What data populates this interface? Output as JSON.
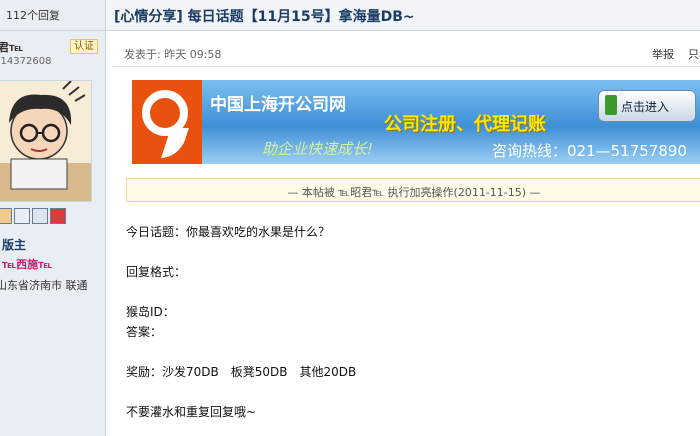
{
  "left": {
    "replies": "112个回复",
    "username": "君℡",
    "verify_badge": "认证",
    "uid": ": 14372608",
    "role": "版主",
    "nickname": "℡西施℡",
    "location": "山东省济南市 联通"
  },
  "thread": {
    "title": "[心情分享] 每日话题【11月15号】拿海量DB~",
    "posted": "发表于: 昨天 09:58",
    "report": "举报",
    "reply_link": "只看"
  },
  "banner": {
    "company": "中国上海开公司网",
    "service": "公司注册、代理记账",
    "slogan": "助企业快速成长!",
    "hotline": "咨询热线：021—51757890",
    "enter_button": "点击进入"
  },
  "notice": "— 本帖被 ℡昭君℡ 执行加亮操作(2011-11-15) —",
  "post": {
    "topic": "今日话题：你最喜欢吃的水果是什么？",
    "format_label": "回复格式：",
    "id_label": "猴岛ID：",
    "answer_label": "答案：",
    "reward": "奖励：沙发70DB　板凳50DB　其他20DB",
    "warning": "不要灌水和重复回复哦~"
  },
  "colors": {
    "accent": "#1b3c66",
    "banner_blue": "#3f8fd6",
    "logo_orange": "#e9520e",
    "notice_bg": "#fffbe6"
  }
}
